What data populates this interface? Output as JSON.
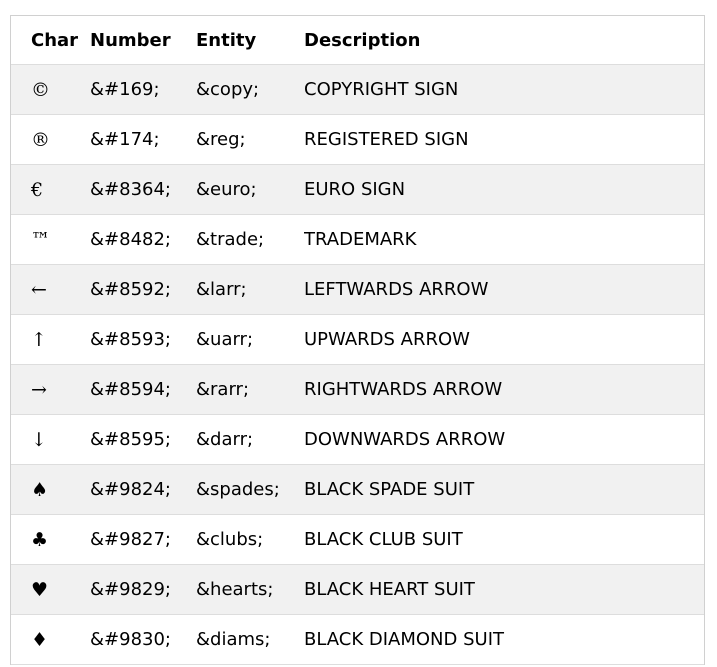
{
  "table": {
    "headers": [
      "Char",
      "Number",
      "Entity",
      "Description"
    ],
    "rows": [
      {
        "char": "©",
        "number": "&#169;",
        "entity": "&copy;",
        "description": "COPYRIGHT SIGN"
      },
      {
        "char": "®",
        "number": "&#174;",
        "entity": "&reg;",
        "description": "REGISTERED SIGN"
      },
      {
        "char": "€",
        "number": "&#8364;",
        "entity": "&euro;",
        "description": "EURO SIGN"
      },
      {
        "char": "™",
        "number": "&#8482;",
        "entity": "&trade;",
        "description": "TRADEMARK"
      },
      {
        "char": "←",
        "number": "&#8592;",
        "entity": "&larr;",
        "description": "LEFTWARDS ARROW"
      },
      {
        "char": "↑",
        "number": "&#8593;",
        "entity": "&uarr;",
        "description": "UPWARDS ARROW"
      },
      {
        "char": "→",
        "number": "&#8594;",
        "entity": "&rarr;",
        "description": "RIGHTWARDS ARROW"
      },
      {
        "char": "↓",
        "number": "&#8595;",
        "entity": "&darr;",
        "description": "DOWNWARDS ARROW"
      },
      {
        "char": "♠",
        "number": "&#9824;",
        "entity": "&spades;",
        "description": "BLACK SPADE SUIT"
      },
      {
        "char": "♣",
        "number": "&#9827;",
        "entity": "&clubs;",
        "description": "BLACK CLUB SUIT"
      },
      {
        "char": "♥",
        "number": "&#9829;",
        "entity": "&hearts;",
        "description": "BLACK HEART SUIT"
      },
      {
        "char": "♦",
        "number": "&#9830;",
        "entity": "&diams;",
        "description": "BLACK DIAMOND SUIT"
      }
    ]
  }
}
